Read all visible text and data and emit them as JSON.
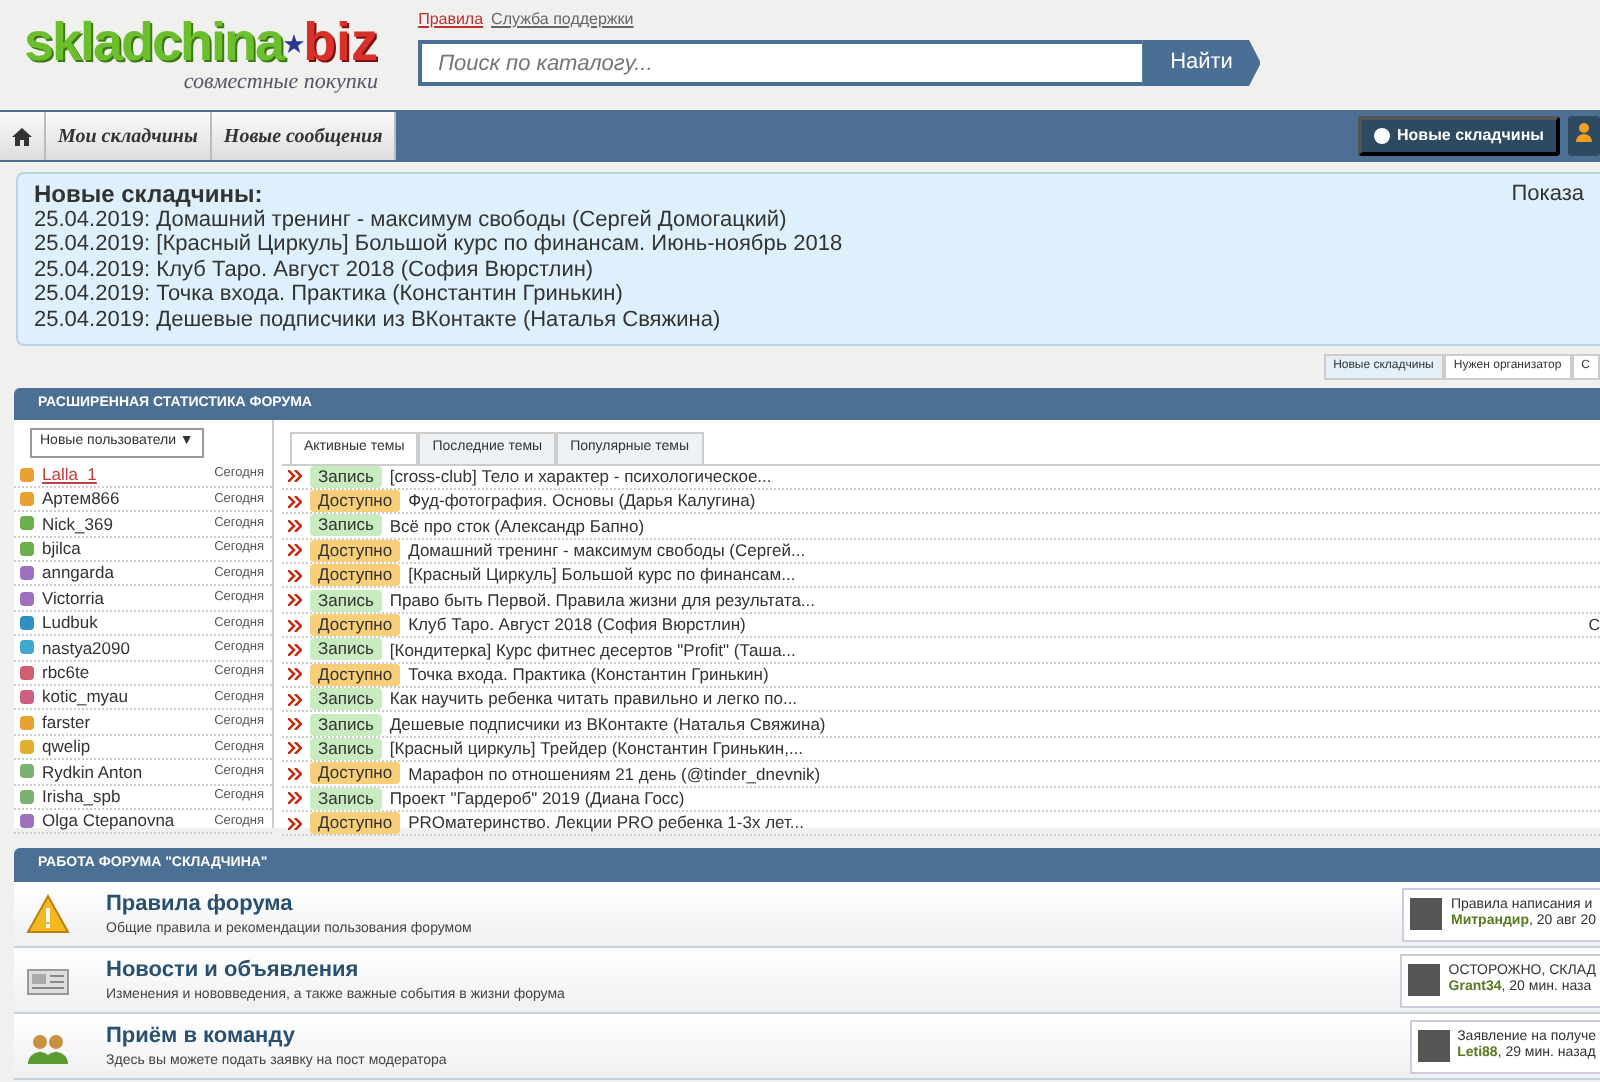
{
  "header": {
    "logo": {
      "name": "skladchina",
      "tld": "biz",
      "tagline": "совместные покупки"
    },
    "top_links": [
      "Правила",
      "Служба поддержки"
    ],
    "search": {
      "placeholder": "Поиск по каталогу...",
      "button": "Найти"
    }
  },
  "navbar": {
    "tabs": [
      {
        "label": "Мои складчины",
        "selected": false
      },
      {
        "label": "Новые сообщения",
        "selected": false
      }
    ],
    "right_button": "Новые складчины"
  },
  "new_box": {
    "title": "Новые складчины:",
    "right_text": "Показа",
    "items": [
      "25.04.2019: Домашний тренинг - максимум свободы (Сергей Домогацкий)",
      "25.04.2019: [Красный Циркуль] Большой курс по финансам. Июнь-ноябрь 2018",
      "25.04.2019: Клуб Таро. Август 2018 (София Вюрстлин)",
      "25.04.2019: Точка входа. Практика (Константин Гринькин)",
      "25.04.2019: Дешевые подписчики из ВКонтакте (Наталья Свяжина)"
    ]
  },
  "box_tabs": [
    {
      "label": "Новые складчины",
      "selected": true
    },
    {
      "label": "Нужен организатор",
      "selected": false
    },
    {
      "label": "С",
      "selected": false
    }
  ],
  "stats": {
    "title": "РАСШИРЕННАЯ СТАТИСТИКА ФОРУМА",
    "users_dropdown": "Новые пользователи ▼",
    "topic_tabs": [
      {
        "label": "Активные темы",
        "selected": true
      },
      {
        "label": "Последние темы",
        "selected": false
      },
      {
        "label": "Популярные темы",
        "selected": false
      }
    ],
    "right_edge_text": "С",
    "users": [
      {
        "name": "Lalla_1",
        "when": "Сегодня",
        "color": "#e8a030",
        "selected": true
      },
      {
        "name": "Артем866",
        "when": "Сегодня",
        "color": "#e8a030",
        "selected": false
      },
      {
        "name": "Nick_369",
        "when": "Сегодня",
        "color": "#6ab04c",
        "selected": false
      },
      {
        "name": "bjilca",
        "when": "Сегодня",
        "color": "#6ab04c",
        "selected": false
      },
      {
        "name": "anngarda",
        "when": "Сегодня",
        "color": "#a070c0",
        "selected": false
      },
      {
        "name": "Victorria",
        "when": "Сегодня",
        "color": "#a070c0",
        "selected": false
      },
      {
        "name": "Ludbuk",
        "when": "Сегодня",
        "color": "#3090c0",
        "selected": false
      },
      {
        "name": "nastya2090",
        "when": "Сегодня",
        "color": "#40a8d0",
        "selected": false
      },
      {
        "name": "rbc6te",
        "when": "Сегодня",
        "color": "#d06070",
        "selected": false
      },
      {
        "name": "kotic_myau",
        "when": "Сегодня",
        "color": "#d06080",
        "selected": false
      },
      {
        "name": "farster",
        "when": "Сегодня",
        "color": "#e8a030",
        "selected": false
      },
      {
        "name": "qwelip",
        "when": "Сегодня",
        "color": "#e0b030",
        "selected": false
      },
      {
        "name": "Rydkin Anton",
        "when": "Сегодня",
        "color": "#7ab070",
        "selected": false
      },
      {
        "name": "Irisha_spb",
        "when": "Сегодня",
        "color": "#7ab070",
        "selected": false
      },
      {
        "name": "Olga Ctepanovna",
        "when": "Сегодня",
        "color": "#a070c0",
        "selected": false
      }
    ],
    "topics": [
      {
        "kind": "signup",
        "tag": "Запись",
        "title": "[cross-club] Тело и характер - психологическое..."
      },
      {
        "kind": "available",
        "tag": "Доступно",
        "title": "Фуд-фотография. Основы (Дарья Калугина)"
      },
      {
        "kind": "signup",
        "tag": "Запись",
        "title": "Всё про сток (Александр Бапно)"
      },
      {
        "kind": "available",
        "tag": "Доступно",
        "title": "Домашний тренинг - максимум свободы (Сергей..."
      },
      {
        "kind": "available",
        "tag": "Доступно",
        "title": "[Красный Циркуль] Большой курс по финансам..."
      },
      {
        "kind": "signup",
        "tag": "Запись",
        "title": "Право быть Первой. Правила жизни для результата..."
      },
      {
        "kind": "available",
        "tag": "Доступно",
        "title": "Клуб Таро. Август 2018 (София Вюрстлин)"
      },
      {
        "kind": "signup",
        "tag": "Запись",
        "title": "[Кондитерка] Курс фитнес десертов \"Profit\" (Таша..."
      },
      {
        "kind": "available",
        "tag": "Доступно",
        "title": "Точка входа. Практика (Константин Гринькин)"
      },
      {
        "kind": "signup",
        "tag": "Запись",
        "title": "Как научить ребенка читать правильно и легко по..."
      },
      {
        "kind": "signup",
        "tag": "Запись",
        "title": "Дешевые подписчики из ВКонтакте (Наталья Свяжина)"
      },
      {
        "kind": "signup",
        "tag": "Запись",
        "title": "[Красный циркуль] Трейдер (Константин Гринькин,..."
      },
      {
        "kind": "available",
        "tag": "Доступно",
        "title": "Марафон по отношениям 21 день (@tinder_dnevnik)"
      },
      {
        "kind": "signup",
        "tag": "Запись",
        "title": "Проект \"Гардероб\" 2019 (Диана Госс)"
      },
      {
        "kind": "available",
        "tag": "Доступно",
        "title": "PROматеринство. Лекции PRO ребенка 1-3х лет..."
      }
    ]
  },
  "forum": {
    "title": "РАБОТА ФОРУМА \"СКЛАДЧИНА\"",
    "nodes": [
      {
        "kind": "warning",
        "title": "Правила форума",
        "description": "Общие правила и рекомендации пользования форумом",
        "last_title": "Правила написания и",
        "last_user": "Митрандир",
        "last_time": ", 20 авг 20"
      },
      {
        "kind": "news",
        "title": "Новости и объявления",
        "description": "Изменения и нововведения, а также важные события в жизни форума",
        "last_title": "ОСТОРОЖНО, СКЛАД",
        "last_user": "Grant34",
        "last_time": ", 20 мин. наза"
      },
      {
        "kind": "team",
        "title": "Приём в команду",
        "description": "Здесь вы можете подать заявку на пост модератора",
        "last_title": "Заявление на получе",
        "last_user": "Leti88",
        "last_time": ", 29 мин. назад"
      }
    ]
  }
}
